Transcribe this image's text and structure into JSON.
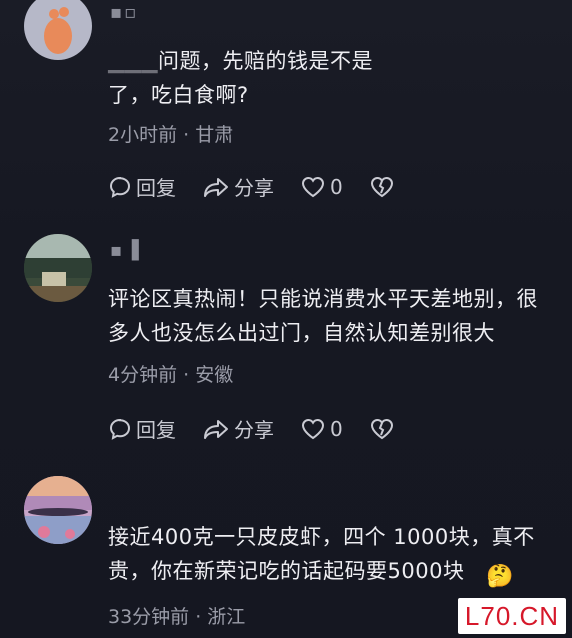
{
  "comments": [
    {
      "username": "▪▫",
      "text_visible": "问题，先赔的钱是不是",
      "text_line2": "了，吃白食啊?",
      "meta": "2小时前 · 甘肃",
      "reply_label": "回复",
      "share_label": "分享",
      "like_count": "0"
    },
    {
      "username": "▪ ▌",
      "text": "评论区真热闹！只能说消费水平天差地别，很多人也没怎么出过门，自然认知差别很大",
      "meta": "4分钟前 · 安徽",
      "reply_label": "回复",
      "share_label": "分享",
      "like_count": "0"
    },
    {
      "username": "",
      "text": "接近400克一只皮皮虾，四个 1000块，真不贵，你在新荣记吃的话起码要5000块",
      "meta": "33分钟前 · 浙江"
    }
  ],
  "watermark": "L70.CN",
  "colors": {
    "background": "#161822",
    "text": "#eeeef2",
    "muted": "#9a9ca8",
    "watermark_red": "#d6182a"
  }
}
